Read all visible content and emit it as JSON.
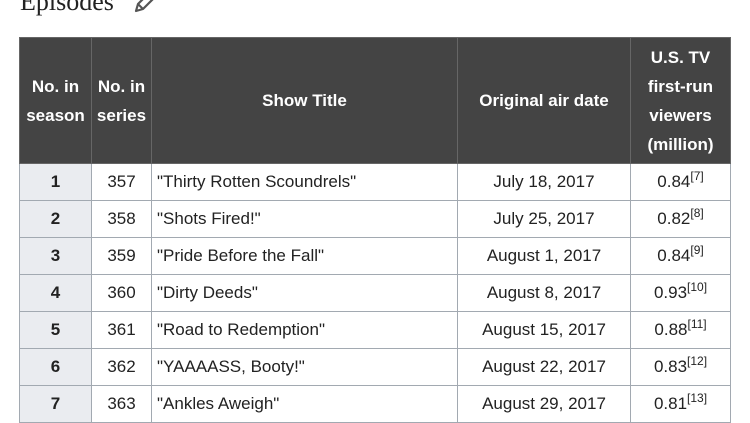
{
  "section": {
    "heading": "Episodes"
  },
  "table": {
    "headers": {
      "season": [
        "No. in",
        "season"
      ],
      "series": [
        "No. in",
        "series"
      ],
      "title": "Show Title",
      "airdate": "Original air date",
      "viewers": [
        "U.S. TV",
        "first-run",
        "viewers",
        "(million)"
      ]
    },
    "rows": [
      {
        "season": "1",
        "series": "357",
        "title": "\"Thirty Rotten Scoundrels\"",
        "airdate": "July 18, 2017",
        "viewers": "0.84",
        "ref": "[7]"
      },
      {
        "season": "2",
        "series": "358",
        "title": "\"Shots Fired!\"",
        "airdate": "July 25, 2017",
        "viewers": "0.82",
        "ref": "[8]"
      },
      {
        "season": "3",
        "series": "359",
        "title": "\"Pride Before the Fall\"",
        "airdate": "August 1, 2017",
        "viewers": "0.84",
        "ref": "[9]"
      },
      {
        "season": "4",
        "series": "360",
        "title": "\"Dirty Deeds\"",
        "airdate": "August 8, 2017",
        "viewers": "0.93",
        "ref": "[10]"
      },
      {
        "season": "5",
        "series": "361",
        "title": "\"Road to Redemption\"",
        "airdate": "August 15, 2017",
        "viewers": "0.88",
        "ref": "[11]"
      },
      {
        "season": "6",
        "series": "362",
        "title": "\"YAAAASS, Booty!\"",
        "airdate": "August 22, 2017",
        "viewers": "0.83",
        "ref": "[12]"
      },
      {
        "season": "7",
        "series": "363",
        "title": "\"Ankles Aweigh\"",
        "airdate": "August 29, 2017",
        "viewers": "0.81",
        "ref": "[13]"
      }
    ]
  }
}
